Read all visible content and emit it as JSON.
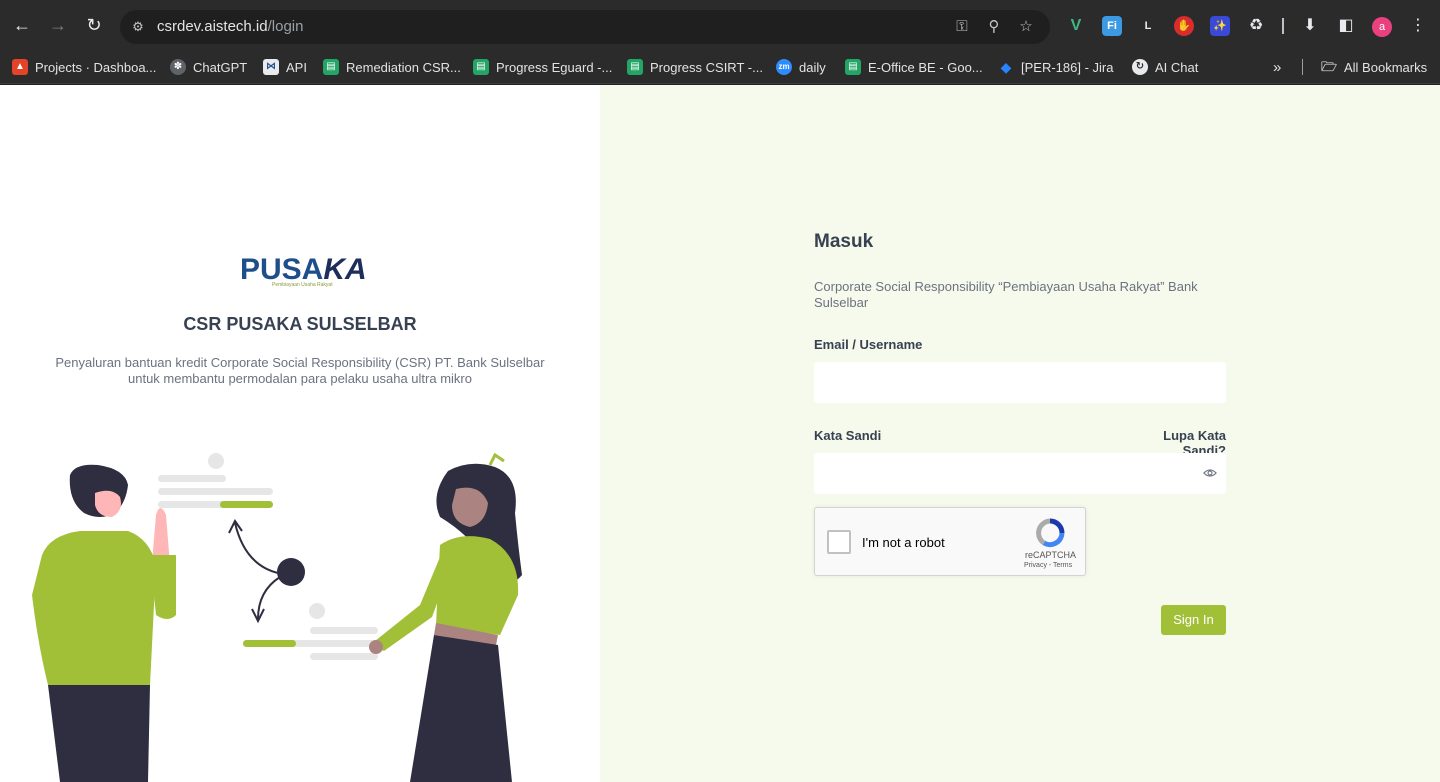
{
  "browser": {
    "url_host": "csrdev.aistech.id",
    "url_path": "/login",
    "profile_initial": "a",
    "bookmarks": [
      {
        "label": "Projects · Dashboa...",
        "icon": "gitlab-icon",
        "color": "#e24329"
      },
      {
        "label": "ChatGPT",
        "icon": "chatgpt-icon",
        "color": "#9aa0a6"
      },
      {
        "label": "API",
        "icon": "api-icon",
        "color": "#e8eaed"
      },
      {
        "label": "Remediation CSR...",
        "icon": "sheets-icon",
        "color": "#23a566"
      },
      {
        "label": "Progress Eguard -...",
        "icon": "sheets-icon",
        "color": "#23a566"
      },
      {
        "label": "Progress CSIRT -...",
        "icon": "sheets-icon",
        "color": "#23a566"
      },
      {
        "label": "daily",
        "icon": "zoom-icon",
        "color": "#2d8cff"
      },
      {
        "label": "E-Office BE - Goo...",
        "icon": "sheets-icon",
        "color": "#23a566"
      },
      {
        "label": "[PER-186] - Jira",
        "icon": "jira-icon",
        "color": "#2684ff"
      },
      {
        "label": "AI Chat",
        "icon": "ai-chat-icon",
        "color": "#e8eaed"
      }
    ],
    "all_bookmarks": "All Bookmarks"
  },
  "brand": {
    "logo_main": "PUSA",
    "logo_accent": "KA",
    "logo_sub": "Pembiayaan Usaha Rakyat",
    "title": "CSR PUSAKA SULSELBAR",
    "description": "Penyaluran bantuan kredit Corporate Social Responsibility (CSR) PT. Bank Sulselbar untuk membantu permodalan para pelaku usaha ultra mikro"
  },
  "form": {
    "title": "Masuk",
    "description": "Corporate Social Responsibility “Pembiayaan Usaha Rakyat” Bank Sulselbar",
    "email_label": "Email / Username",
    "email_value": "",
    "password_label": "Kata Sandi",
    "forgot_label": "Lupa Kata Sandi?",
    "password_value": "",
    "captcha_label": "I'm not a robot",
    "captcha_brand": "reCAPTCHA",
    "captcha_links": "Privacy - Terms",
    "submit_label": "Sign In"
  },
  "colors": {
    "accent": "#a2c037",
    "panel_bg": "#f6faec",
    "brand_blue": "#1e4f8a"
  }
}
